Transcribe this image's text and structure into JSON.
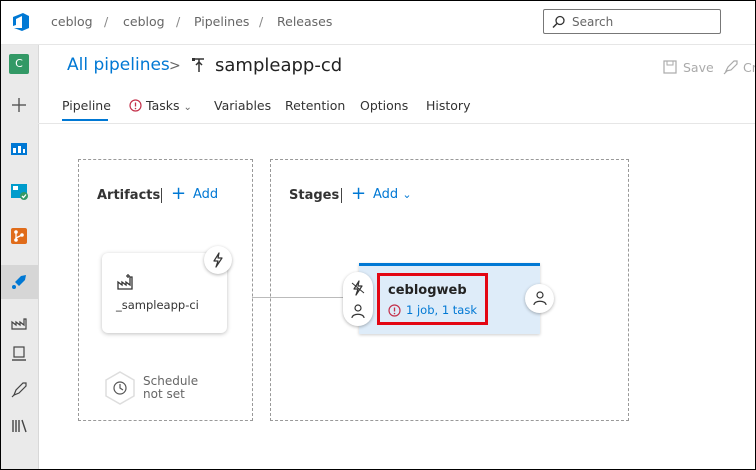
{
  "breadcrumbs": [
    "ceblog",
    "ceblog",
    "Pipelines",
    "Releases"
  ],
  "search": {
    "placeholder": "Search"
  },
  "project": {
    "initial": "C"
  },
  "header": {
    "all_pipelines": "All pipelines",
    "pipeline_name": "sampleapp-cd",
    "save_label": "Save",
    "create_label": "Cr"
  },
  "tabs": [
    {
      "label": "Pipeline"
    },
    {
      "label": "Tasks"
    },
    {
      "label": "Variables"
    },
    {
      "label": "Retention"
    },
    {
      "label": "Options"
    },
    {
      "label": "History"
    }
  ],
  "artifacts": {
    "title": "Artifacts",
    "add_label": "Add",
    "items": [
      {
        "name": "_sampleapp-ci"
      }
    ],
    "schedule": {
      "line1": "Schedule",
      "line2": "not set"
    }
  },
  "stages": {
    "title": "Stages",
    "add_label": "Add",
    "items": [
      {
        "name": "ceblogweb",
        "status": "1 job, 1 task"
      }
    ]
  },
  "colors": {
    "accent": "#0078d4",
    "stage_bg": "#deecf9",
    "highlight": "#e30613",
    "error": "#c4314b"
  }
}
